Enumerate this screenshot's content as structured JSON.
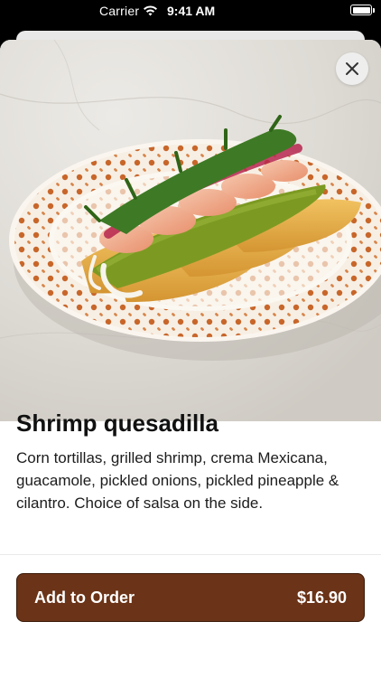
{
  "status_bar": {
    "carrier": "Carrier",
    "time": "9:41 AM"
  },
  "item": {
    "title": "Shrimp quesadilla",
    "description": "Corn tortillas, grilled shrimp, crema Mexicana, guacamole, pickled onions, pickled pineapple & cilantro. Choice of salsa on the side."
  },
  "order_button": {
    "label": "Add to Order",
    "price": "$16.90"
  },
  "icons": {
    "close": "close-icon",
    "wifi": "wifi-icon",
    "battery": "battery-icon"
  },
  "colors": {
    "button_bg": "#6b3317",
    "button_text": "#ffffff",
    "title_text": "#111111"
  }
}
